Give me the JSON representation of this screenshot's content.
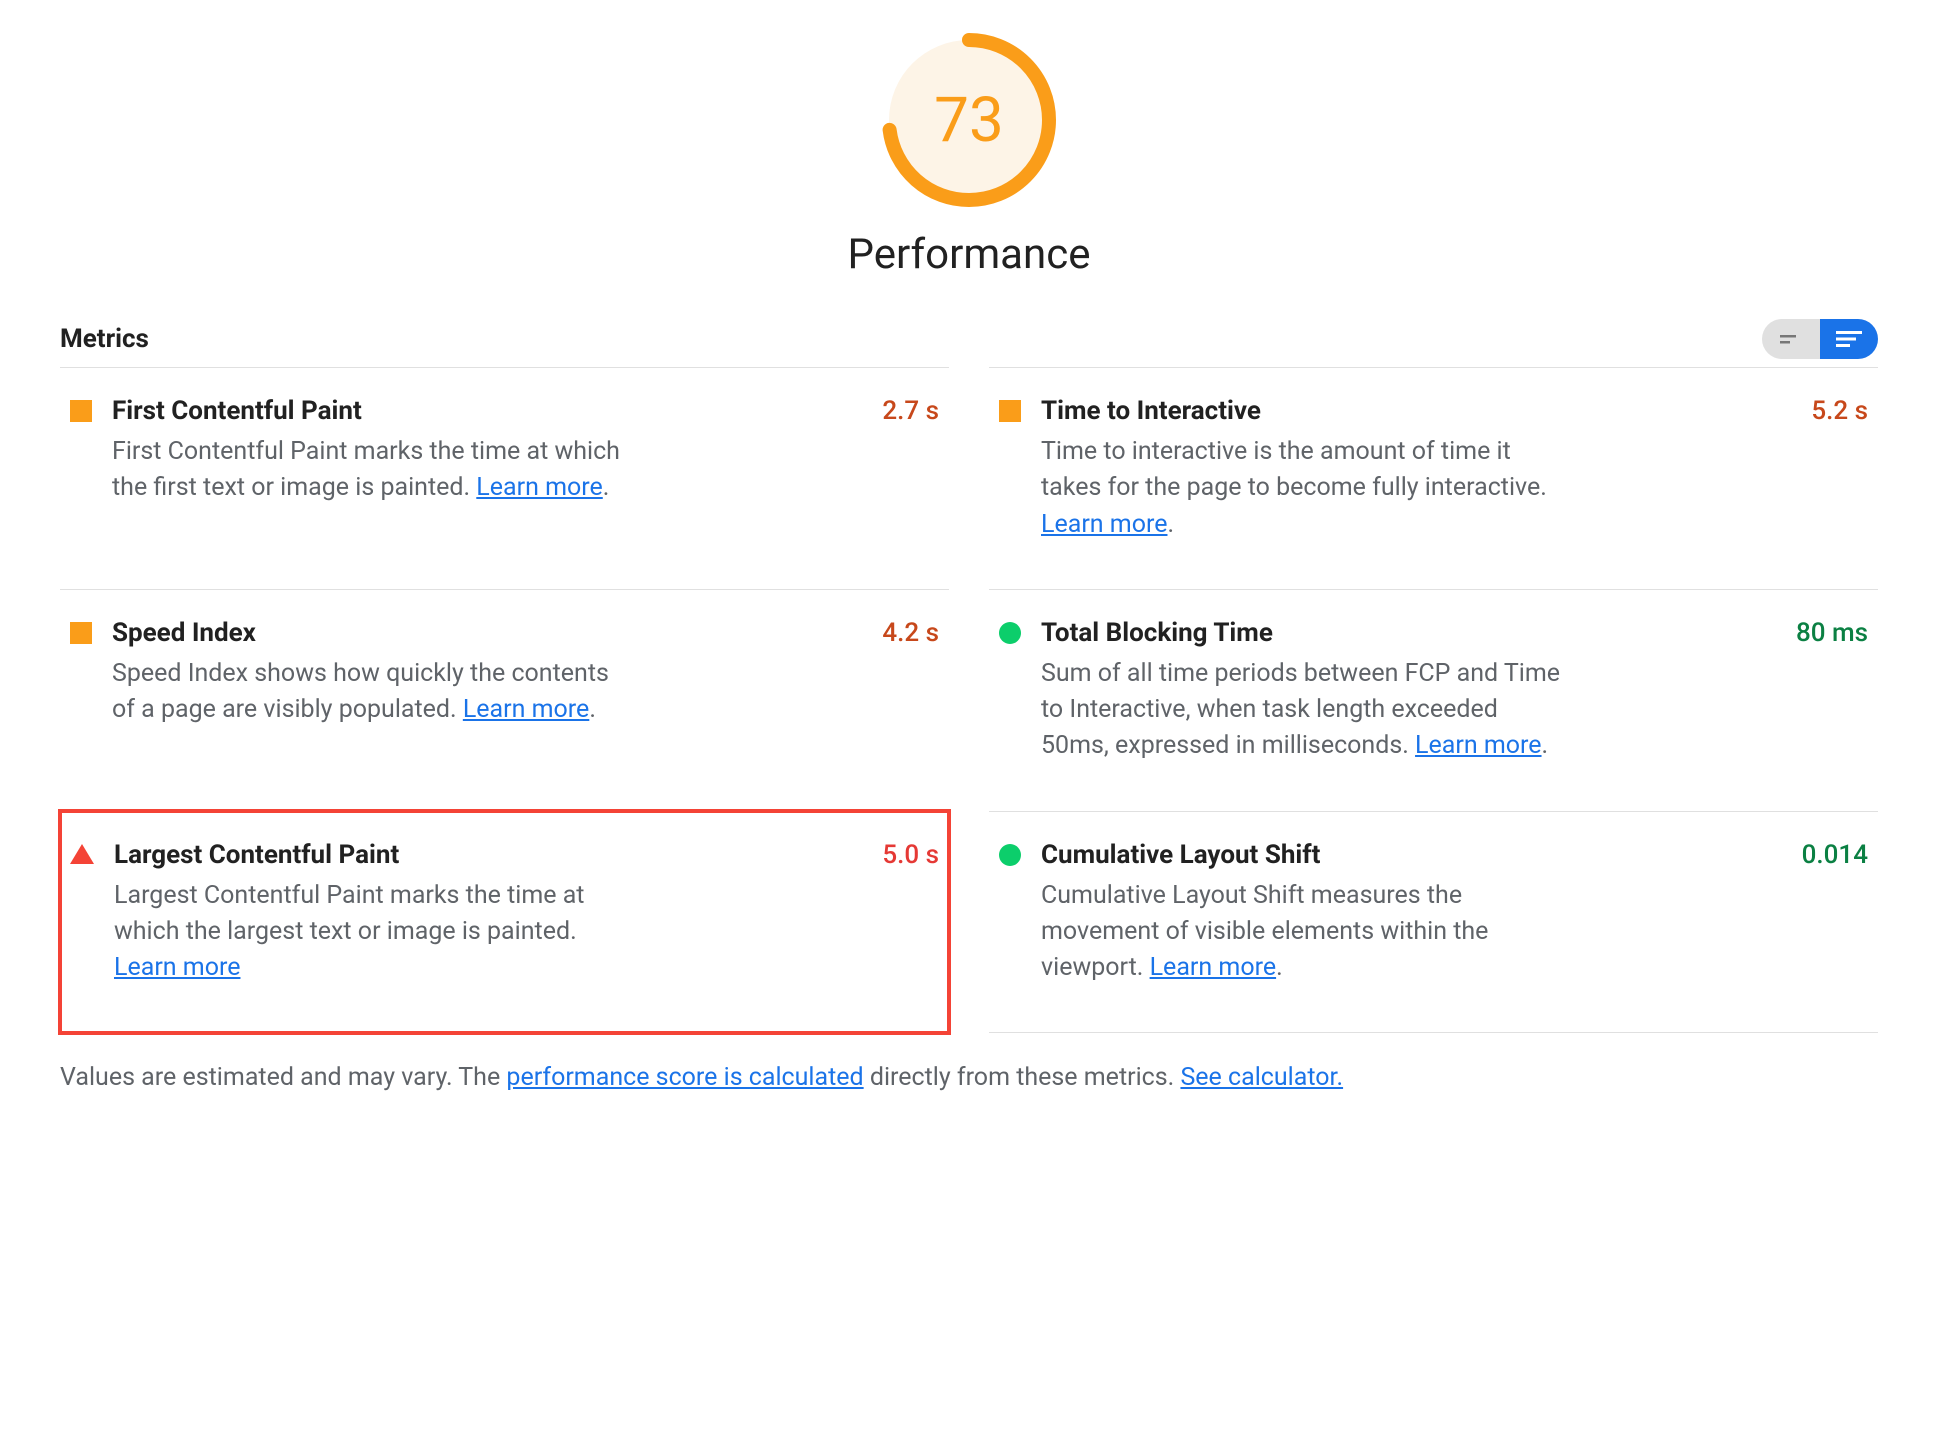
{
  "gauge": {
    "score": 73,
    "category": "Performance",
    "color": "#fa9d19",
    "bg": "#fdf4e7"
  },
  "metrics_label": "Metrics",
  "metrics": [
    {
      "title": "First Contentful Paint",
      "desc_pre": "First Contentful Paint marks the time at which the first text or image is painted. ",
      "learn": "Learn more",
      "desc_post": ".",
      "value": "2.7 s",
      "status": "square",
      "value_class": "avg",
      "highlighted": false
    },
    {
      "title": "Time to Interactive",
      "desc_pre": "Time to interactive is the amount of time it takes for the page to become fully interactive. ",
      "learn": "Learn more",
      "desc_post": ".",
      "value": "5.2 s",
      "status": "square",
      "value_class": "avg",
      "highlighted": false
    },
    {
      "title": "Speed Index",
      "desc_pre": "Speed Index shows how quickly the contents of a page are visibly populated. ",
      "learn": "Learn more",
      "desc_post": ".",
      "value": "4.2 s",
      "status": "square",
      "value_class": "avg",
      "highlighted": false
    },
    {
      "title": "Total Blocking Time",
      "desc_pre": "Sum of all time periods between FCP and Time to Interactive, when task length exceeded 50ms, expressed in milliseconds. ",
      "learn": "Learn more",
      "desc_post": ".",
      "value": "80 ms",
      "status": "circle",
      "value_class": "good",
      "highlighted": false
    },
    {
      "title": "Largest Contentful Paint",
      "desc_pre": "Largest Contentful Paint marks the time at which the largest text or image is painted. ",
      "learn": "Learn more",
      "desc_post": "",
      "value": "5.0 s",
      "status": "triangle",
      "value_class": "fail",
      "highlighted": true
    },
    {
      "title": "Cumulative Layout Shift",
      "desc_pre": "Cumulative Layout Shift measures the movement of visible elements within the viewport. ",
      "learn": "Learn more",
      "desc_post": ".",
      "value": "0.014",
      "status": "circle",
      "value_class": "good",
      "highlighted": false
    }
  ],
  "footnote": {
    "pre": "Values are estimated and may vary. The ",
    "link1": "performance score is calculated",
    "mid": " directly from these metrics. ",
    "link2": "See calculator."
  }
}
